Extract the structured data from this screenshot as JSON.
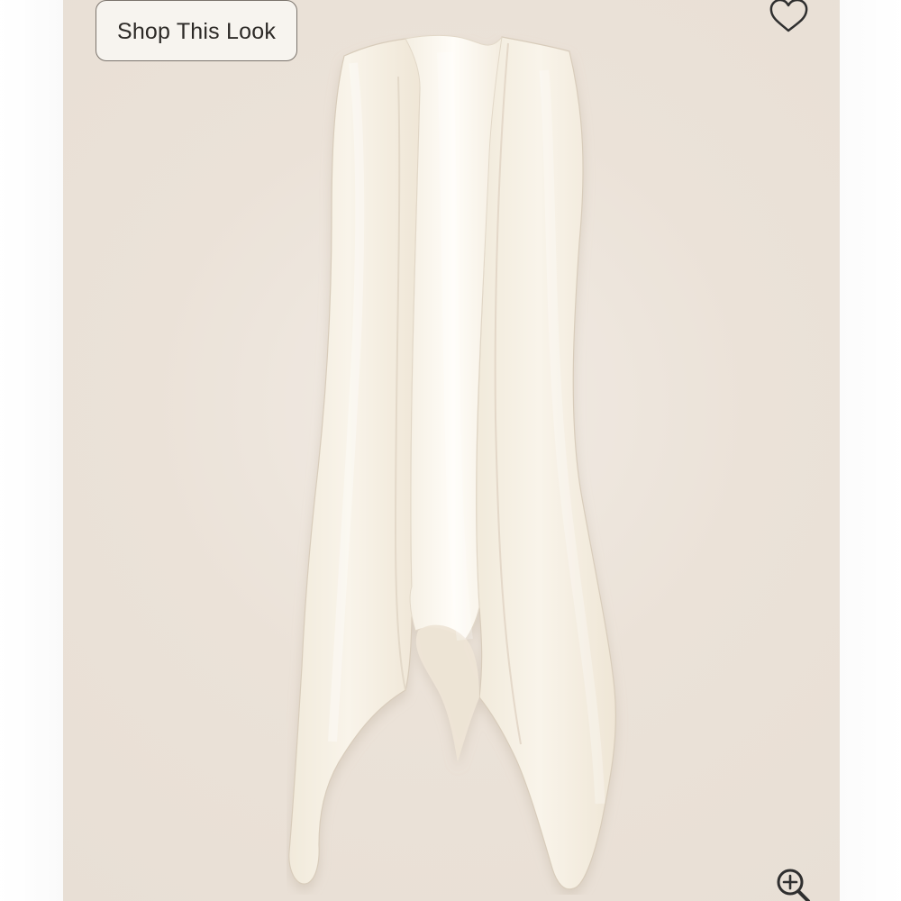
{
  "product_view": {
    "shop_look_label": "Shop This Look",
    "icons": {
      "favorite": "heart-icon",
      "zoom": "zoom-in-icon"
    },
    "colors": {
      "background": "#ebe2d8",
      "garment": "#f7f1e5",
      "icon_stroke": "#2f2f2f",
      "button_border": "#7b746d"
    }
  }
}
